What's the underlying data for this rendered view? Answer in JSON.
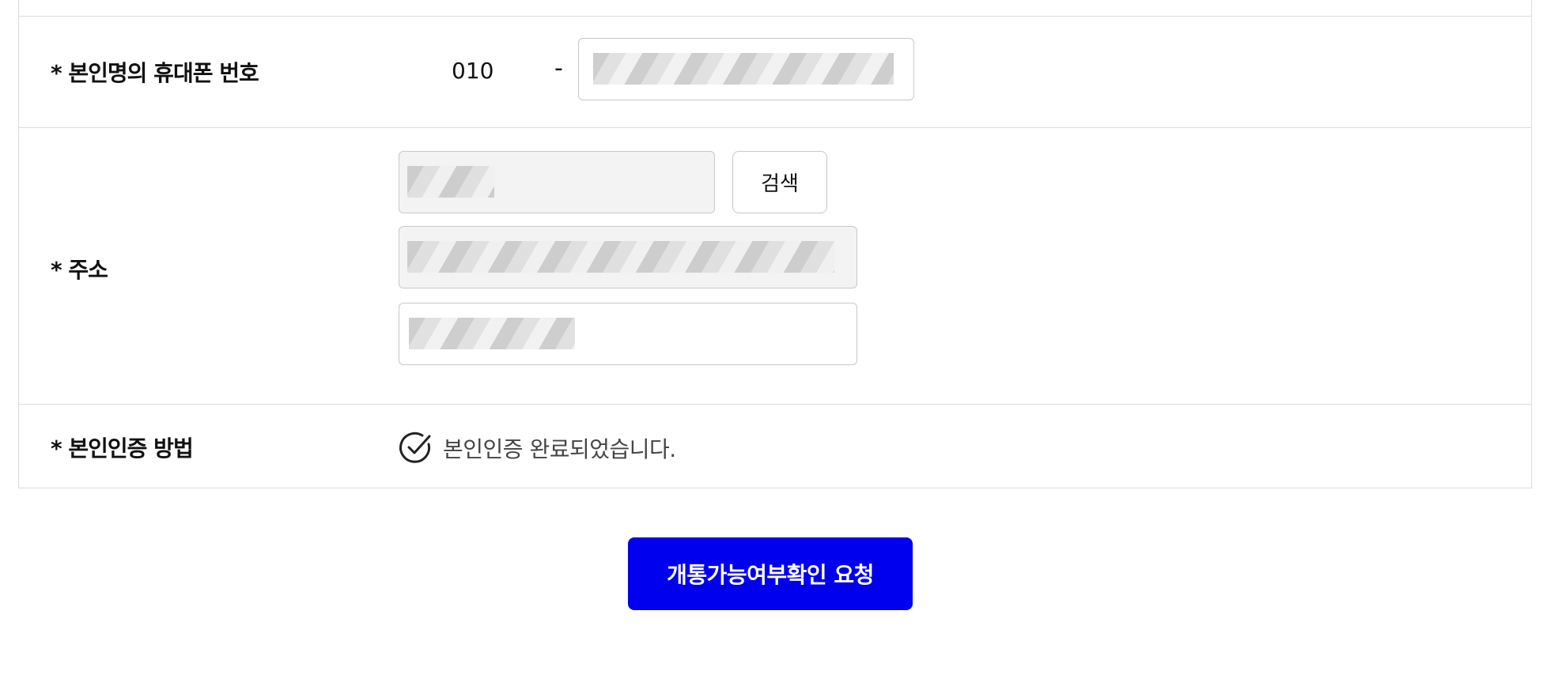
{
  "form": {
    "phone": {
      "label": "* 본인명의 휴대폰 번호",
      "prefix": "010",
      "separator": "-"
    },
    "address": {
      "label": "* 주소",
      "search_button": "검색"
    },
    "auth": {
      "label": "* 본인인증 방법",
      "status_text": "본인인증 완료되었습니다.",
      "icon": "check-circle-icon"
    }
  },
  "submit": {
    "label": "개통가능여부확인 요청",
    "color": "#0000ee"
  }
}
